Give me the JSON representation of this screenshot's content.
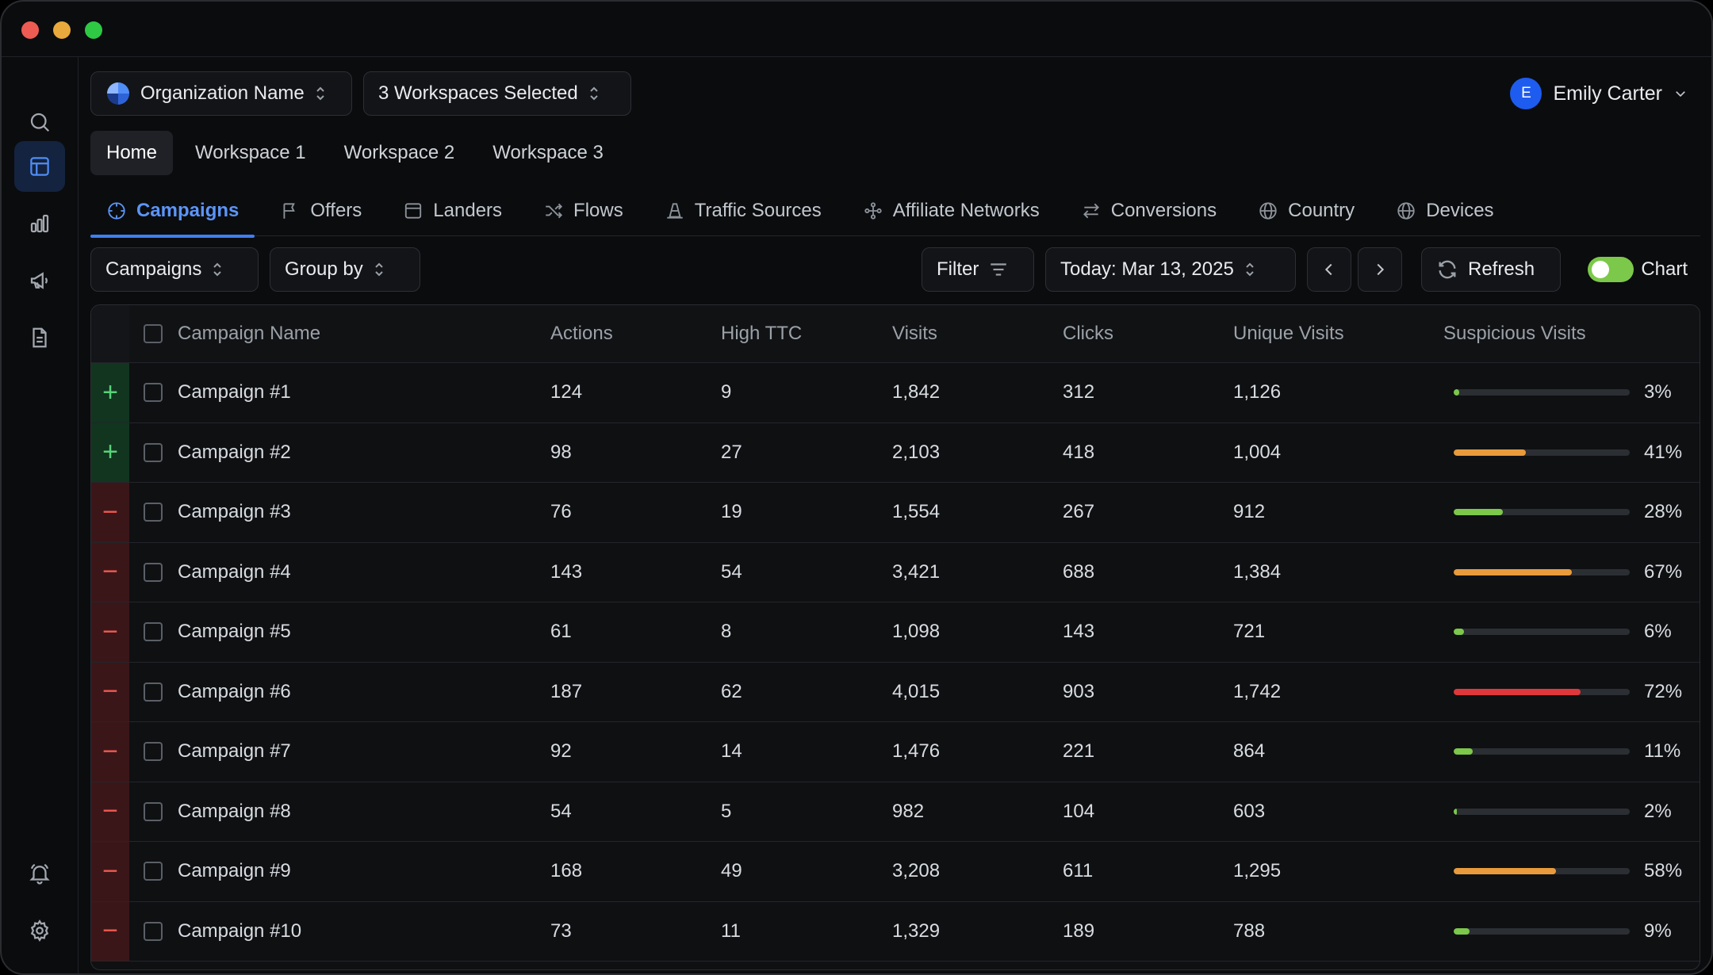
{
  "org_selector": {
    "label": "Organization Name"
  },
  "workspace_selector": {
    "label": "3 Workspaces Selected"
  },
  "user": {
    "initial": "E",
    "name": "Emily Carter"
  },
  "workspace_tabs": [
    "Home",
    "Workspace 1",
    "Workspace 2",
    "Workspace 3"
  ],
  "nav_tabs": [
    "Campaigns",
    "Offers",
    "Landers",
    "Flows",
    "Traffic Sources",
    "Affiliate Networks",
    "Conversions",
    "Country",
    "Devices"
  ],
  "toolbar": {
    "entity_select": "Campaigns",
    "group_by": "Group by",
    "filter": "Filter",
    "date": "Today: Mar 13, 2025",
    "refresh": "Refresh",
    "chart_label": "Chart",
    "chart_toggle_on": true
  },
  "table": {
    "columns": [
      "Campaign Name",
      "Actions",
      "High TTC",
      "Visits",
      "Clicks",
      "Unique Visits",
      "Suspicious Visits"
    ],
    "rows": [
      {
        "marker": "+",
        "name": "Campaign #1",
        "actions": "124",
        "high_ttc": "9",
        "visits": "1,842",
        "clicks": "312",
        "unique": "1,126",
        "suspicious": "3%",
        "fraction": 0.03,
        "color": "#7cc84a"
      },
      {
        "marker": "+",
        "name": "Campaign #2",
        "actions": "98",
        "high_ttc": "27",
        "visits": "2,103",
        "clicks": "418",
        "unique": "1,004",
        "suspicious": "41%",
        "fraction": 0.41,
        "color": "#e89a3c"
      },
      {
        "marker": "−",
        "name": "Campaign #3",
        "actions": "76",
        "high_ttc": "19",
        "visits": "1,554",
        "clicks": "267",
        "unique": "912",
        "suspicious": "28%",
        "fraction": 0.28,
        "color": "#7cc84a"
      },
      {
        "marker": "−",
        "name": "Campaign #4",
        "actions": "143",
        "high_ttc": "54",
        "visits": "3,421",
        "clicks": "688",
        "unique": "1,384",
        "suspicious": "67%",
        "fraction": 0.67,
        "color": "#e89a3c"
      },
      {
        "marker": "−",
        "name": "Campaign #5",
        "actions": "61",
        "high_ttc": "8",
        "visits": "1,098",
        "clicks": "143",
        "unique": "721",
        "suspicious": "6%",
        "fraction": 0.06,
        "color": "#7cc84a"
      },
      {
        "marker": "−",
        "name": "Campaign #6",
        "actions": "187",
        "high_ttc": "62",
        "visits": "4,015",
        "clicks": "903",
        "unique": "1,742",
        "suspicious": "72%",
        "fraction": 0.72,
        "color": "#e0383a"
      },
      {
        "marker": "−",
        "name": "Campaign #7",
        "actions": "92",
        "high_ttc": "14",
        "visits": "1,476",
        "clicks": "221",
        "unique": "864",
        "suspicious": "11%",
        "fraction": 0.11,
        "color": "#7cc84a"
      },
      {
        "marker": "−",
        "name": "Campaign #8",
        "actions": "54",
        "high_ttc": "5",
        "visits": "982",
        "clicks": "104",
        "unique": "603",
        "suspicious": "2%",
        "fraction": 0.02,
        "color": "#7cc84a"
      },
      {
        "marker": "−",
        "name": "Campaign #9",
        "actions": "168",
        "high_ttc": "49",
        "visits": "3,208",
        "clicks": "611",
        "unique": "1,295",
        "suspicious": "58%",
        "fraction": 0.58,
        "color": "#e89a3c"
      },
      {
        "marker": "−",
        "name": "Campaign #10",
        "actions": "73",
        "high_ttc": "11",
        "visits": "1,329",
        "clicks": "189",
        "unique": "788",
        "suspicious": "9%",
        "fraction": 0.09,
        "color": "#7cc84a"
      }
    ]
  }
}
